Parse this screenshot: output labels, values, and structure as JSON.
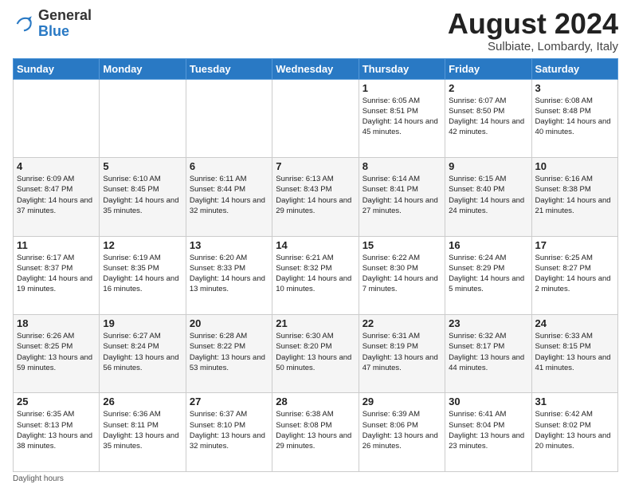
{
  "logo": {
    "line1": "General",
    "line2": "Blue"
  },
  "title": "August 2024",
  "subtitle": "Sulbiate, Lombardy, Italy",
  "weekdays": [
    "Sunday",
    "Monday",
    "Tuesday",
    "Wednesday",
    "Thursday",
    "Friday",
    "Saturday"
  ],
  "footer": "Daylight hours",
  "weeks": [
    [
      {
        "day": "",
        "info": ""
      },
      {
        "day": "",
        "info": ""
      },
      {
        "day": "",
        "info": ""
      },
      {
        "day": "",
        "info": ""
      },
      {
        "day": "1",
        "info": "Sunrise: 6:05 AM\nSunset: 8:51 PM\nDaylight: 14 hours and 45 minutes."
      },
      {
        "day": "2",
        "info": "Sunrise: 6:07 AM\nSunset: 8:50 PM\nDaylight: 14 hours and 42 minutes."
      },
      {
        "day": "3",
        "info": "Sunrise: 6:08 AM\nSunset: 8:48 PM\nDaylight: 14 hours and 40 minutes."
      }
    ],
    [
      {
        "day": "4",
        "info": "Sunrise: 6:09 AM\nSunset: 8:47 PM\nDaylight: 14 hours and 37 minutes."
      },
      {
        "day": "5",
        "info": "Sunrise: 6:10 AM\nSunset: 8:45 PM\nDaylight: 14 hours and 35 minutes."
      },
      {
        "day": "6",
        "info": "Sunrise: 6:11 AM\nSunset: 8:44 PM\nDaylight: 14 hours and 32 minutes."
      },
      {
        "day": "7",
        "info": "Sunrise: 6:13 AM\nSunset: 8:43 PM\nDaylight: 14 hours and 29 minutes."
      },
      {
        "day": "8",
        "info": "Sunrise: 6:14 AM\nSunset: 8:41 PM\nDaylight: 14 hours and 27 minutes."
      },
      {
        "day": "9",
        "info": "Sunrise: 6:15 AM\nSunset: 8:40 PM\nDaylight: 14 hours and 24 minutes."
      },
      {
        "day": "10",
        "info": "Sunrise: 6:16 AM\nSunset: 8:38 PM\nDaylight: 14 hours and 21 minutes."
      }
    ],
    [
      {
        "day": "11",
        "info": "Sunrise: 6:17 AM\nSunset: 8:37 PM\nDaylight: 14 hours and 19 minutes."
      },
      {
        "day": "12",
        "info": "Sunrise: 6:19 AM\nSunset: 8:35 PM\nDaylight: 14 hours and 16 minutes."
      },
      {
        "day": "13",
        "info": "Sunrise: 6:20 AM\nSunset: 8:33 PM\nDaylight: 14 hours and 13 minutes."
      },
      {
        "day": "14",
        "info": "Sunrise: 6:21 AM\nSunset: 8:32 PM\nDaylight: 14 hours and 10 minutes."
      },
      {
        "day": "15",
        "info": "Sunrise: 6:22 AM\nSunset: 8:30 PM\nDaylight: 14 hours and 7 minutes."
      },
      {
        "day": "16",
        "info": "Sunrise: 6:24 AM\nSunset: 8:29 PM\nDaylight: 14 hours and 5 minutes."
      },
      {
        "day": "17",
        "info": "Sunrise: 6:25 AM\nSunset: 8:27 PM\nDaylight: 14 hours and 2 minutes."
      }
    ],
    [
      {
        "day": "18",
        "info": "Sunrise: 6:26 AM\nSunset: 8:25 PM\nDaylight: 13 hours and 59 minutes."
      },
      {
        "day": "19",
        "info": "Sunrise: 6:27 AM\nSunset: 8:24 PM\nDaylight: 13 hours and 56 minutes."
      },
      {
        "day": "20",
        "info": "Sunrise: 6:28 AM\nSunset: 8:22 PM\nDaylight: 13 hours and 53 minutes."
      },
      {
        "day": "21",
        "info": "Sunrise: 6:30 AM\nSunset: 8:20 PM\nDaylight: 13 hours and 50 minutes."
      },
      {
        "day": "22",
        "info": "Sunrise: 6:31 AM\nSunset: 8:19 PM\nDaylight: 13 hours and 47 minutes."
      },
      {
        "day": "23",
        "info": "Sunrise: 6:32 AM\nSunset: 8:17 PM\nDaylight: 13 hours and 44 minutes."
      },
      {
        "day": "24",
        "info": "Sunrise: 6:33 AM\nSunset: 8:15 PM\nDaylight: 13 hours and 41 minutes."
      }
    ],
    [
      {
        "day": "25",
        "info": "Sunrise: 6:35 AM\nSunset: 8:13 PM\nDaylight: 13 hours and 38 minutes."
      },
      {
        "day": "26",
        "info": "Sunrise: 6:36 AM\nSunset: 8:11 PM\nDaylight: 13 hours and 35 minutes."
      },
      {
        "day": "27",
        "info": "Sunrise: 6:37 AM\nSunset: 8:10 PM\nDaylight: 13 hours and 32 minutes."
      },
      {
        "day": "28",
        "info": "Sunrise: 6:38 AM\nSunset: 8:08 PM\nDaylight: 13 hours and 29 minutes."
      },
      {
        "day": "29",
        "info": "Sunrise: 6:39 AM\nSunset: 8:06 PM\nDaylight: 13 hours and 26 minutes."
      },
      {
        "day": "30",
        "info": "Sunrise: 6:41 AM\nSunset: 8:04 PM\nDaylight: 13 hours and 23 minutes."
      },
      {
        "day": "31",
        "info": "Sunrise: 6:42 AM\nSunset: 8:02 PM\nDaylight: 13 hours and 20 minutes."
      }
    ]
  ]
}
